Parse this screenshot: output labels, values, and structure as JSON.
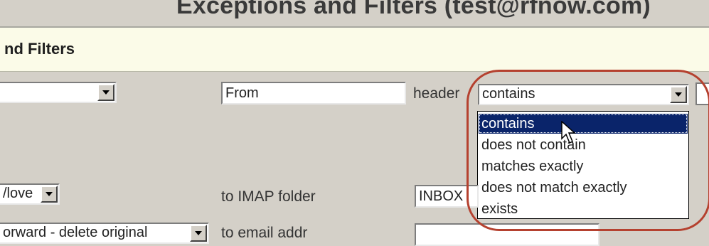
{
  "window": {
    "title": "Exceptions and Filters (test@rfnow.com)"
  },
  "section": {
    "header": "nd Filters"
  },
  "filter": {
    "field_select_value": "",
    "header_input_value": "From",
    "header_label": "header",
    "condition_select_value": "contains",
    "condition_options": [
      "contains",
      "does not contain",
      "matches exactly",
      "does not match exactly",
      "exists"
    ],
    "selected_option_index": 0
  },
  "action": {
    "move_select_value": "/love",
    "to_imap_label": "to IMAP folder",
    "folder_value": "INBOX",
    "forward_select_value": "orward - delete original",
    "email_label": "to email addr"
  },
  "colors": {
    "background": "#d4d0c8",
    "section_bg": "#fbfbe8",
    "highlight_ring": "#b5412f",
    "selection": "#0a246a"
  }
}
